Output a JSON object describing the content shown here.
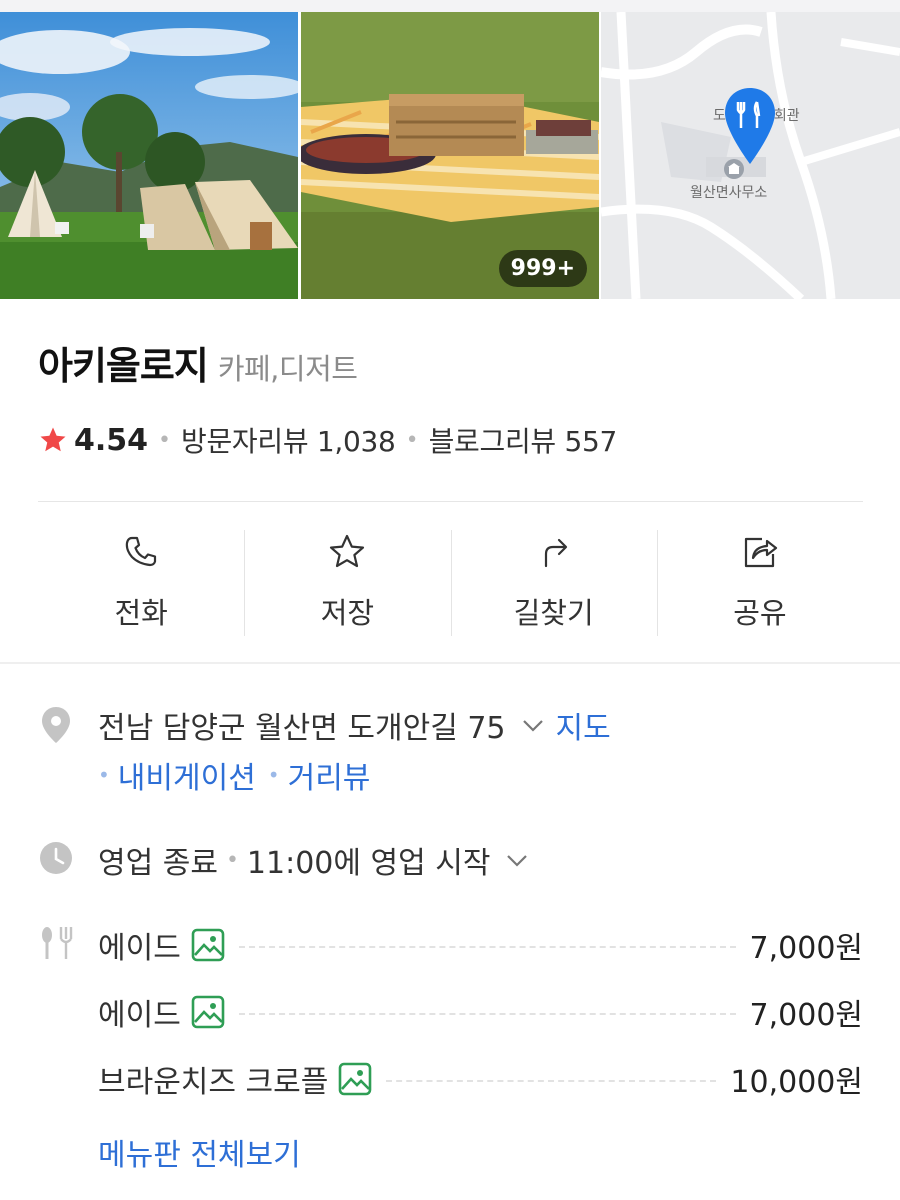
{
  "place": {
    "name": "아키올로지",
    "category": "카페,디저트"
  },
  "photos": {
    "count_badge": "999+",
    "map_labels": [
      "도",
      "회관",
      "월산면사무소"
    ]
  },
  "rating": {
    "score": "4.54",
    "visitor_reviews": "방문자리뷰 1,038",
    "blog_reviews": "블로그리뷰 557"
  },
  "actions": [
    {
      "label": "전화",
      "icon": "phone-icon"
    },
    {
      "label": "저장",
      "icon": "star-outline-icon"
    },
    {
      "label": "길찾기",
      "icon": "directions-icon"
    },
    {
      "label": "공유",
      "icon": "share-icon"
    }
  ],
  "address": {
    "text": "전남 담양군 월산면 도개안길 75",
    "map_link": "지도",
    "navigation_link": "내비게이션",
    "street_view_link": "거리뷰"
  },
  "hours": {
    "status": "영업 종료",
    "next_open": "11:00에 영업 시작"
  },
  "menu": {
    "items": [
      {
        "name": "에이드",
        "price": "7,000원"
      },
      {
        "name": "에이드",
        "price": "7,000원"
      },
      {
        "name": "브라운치즈 크로플",
        "price": "10,000원"
      }
    ],
    "view_all": "메뉴판 전체보기"
  },
  "colors": {
    "link": "#2e6fd6",
    "star": "#f04848",
    "image_icon": "#2f9e55"
  }
}
